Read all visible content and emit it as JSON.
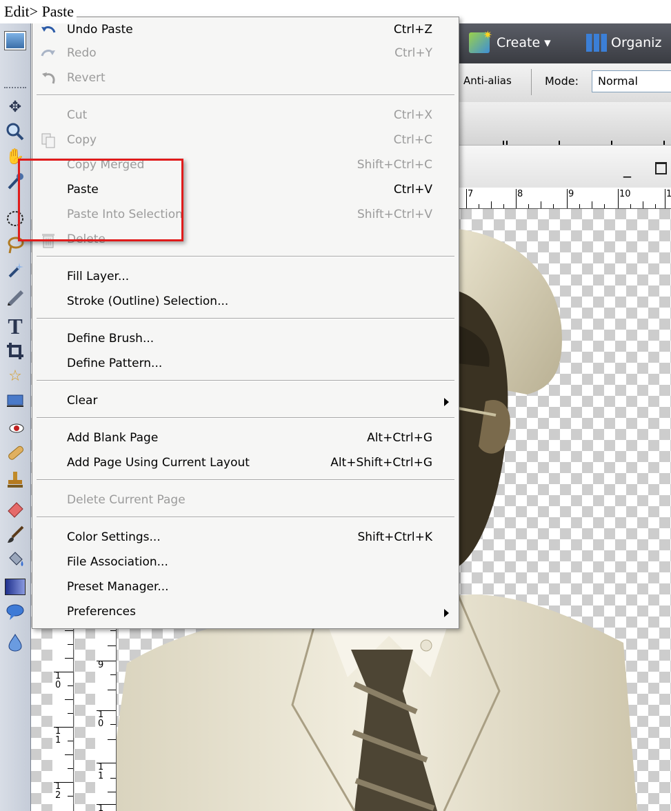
{
  "caption": "Edit> Paste",
  "header": {
    "create_label": "Create ▾",
    "organize_label": "Organiz"
  },
  "options_bar": {
    "antialias_label": "Anti-alias",
    "mode_label": "Mode:",
    "mode_value": "Normal"
  },
  "ruler": {
    "h_numbers": [
      "7",
      "8",
      "9",
      "10",
      "1"
    ],
    "v_left_numbers": [
      "10",
      "11",
      "12"
    ],
    "v_right_numbers": [
      "9",
      "10",
      "11",
      "1"
    ]
  },
  "edit_menu": {
    "undo": {
      "label": "Undo Paste",
      "shortcut": "Ctrl+Z"
    },
    "redo": {
      "label": "Redo",
      "shortcut": "Ctrl+Y"
    },
    "revert": {
      "label": "Revert"
    },
    "cut": {
      "label": "Cut",
      "shortcut": "Ctrl+X"
    },
    "copy": {
      "label": "Copy",
      "shortcut": "Ctrl+C"
    },
    "copy_merged": {
      "label": "Copy Merged",
      "shortcut": "Shift+Ctrl+C"
    },
    "paste": {
      "label": "Paste",
      "shortcut": "Ctrl+V"
    },
    "paste_into": {
      "label": "Paste Into Selection",
      "shortcut": "Shift+Ctrl+V"
    },
    "delete": {
      "label": "Delete"
    },
    "fill_layer": {
      "label": "Fill Layer..."
    },
    "stroke": {
      "label": "Stroke (Outline) Selection..."
    },
    "define_brush": {
      "label": "Define Brush..."
    },
    "define_pattern": {
      "label": "Define Pattern..."
    },
    "clear": {
      "label": "Clear"
    },
    "add_blank_page": {
      "label": "Add Blank Page",
      "shortcut": "Alt+Ctrl+G"
    },
    "add_page_layout": {
      "label": "Add Page Using Current Layout",
      "shortcut": "Alt+Shift+Ctrl+G"
    },
    "delete_page": {
      "label": "Delete Current Page"
    },
    "color_settings": {
      "label": "Color Settings...",
      "shortcut": "Shift+Ctrl+K"
    },
    "file_association": {
      "label": "File Association..."
    },
    "preset_manager": {
      "label": "Preset Manager..."
    },
    "preferences": {
      "label": "Preferences"
    }
  },
  "colors": {
    "highlight": "#e01b1b",
    "disabled_text": "#9b9b9b",
    "menu_bg": "#f6f6f5",
    "header_bg": "#4a4c54"
  },
  "icons": {
    "tools": [
      "photo-bin-icon",
      "move-tool-icon",
      "zoom-tool-icon",
      "hand-tool-icon",
      "eyedropper-tool-icon",
      "marquee-tool-icon",
      "lasso-tool-icon",
      "magic-wand-tool-icon",
      "pencil-tool-icon",
      "type-tool-icon",
      "crop-tool-icon",
      "cookie-cutter-tool-icon",
      "straighten-tool-icon",
      "red-eye-tool-icon",
      "healing-brush-tool-icon",
      "clone-stamp-tool-icon",
      "eraser-tool-icon",
      "brush-tool-icon",
      "paint-bucket-tool-icon",
      "gradient-tool-icon",
      "shape-tool-icon",
      "blur-tool-icon"
    ]
  }
}
